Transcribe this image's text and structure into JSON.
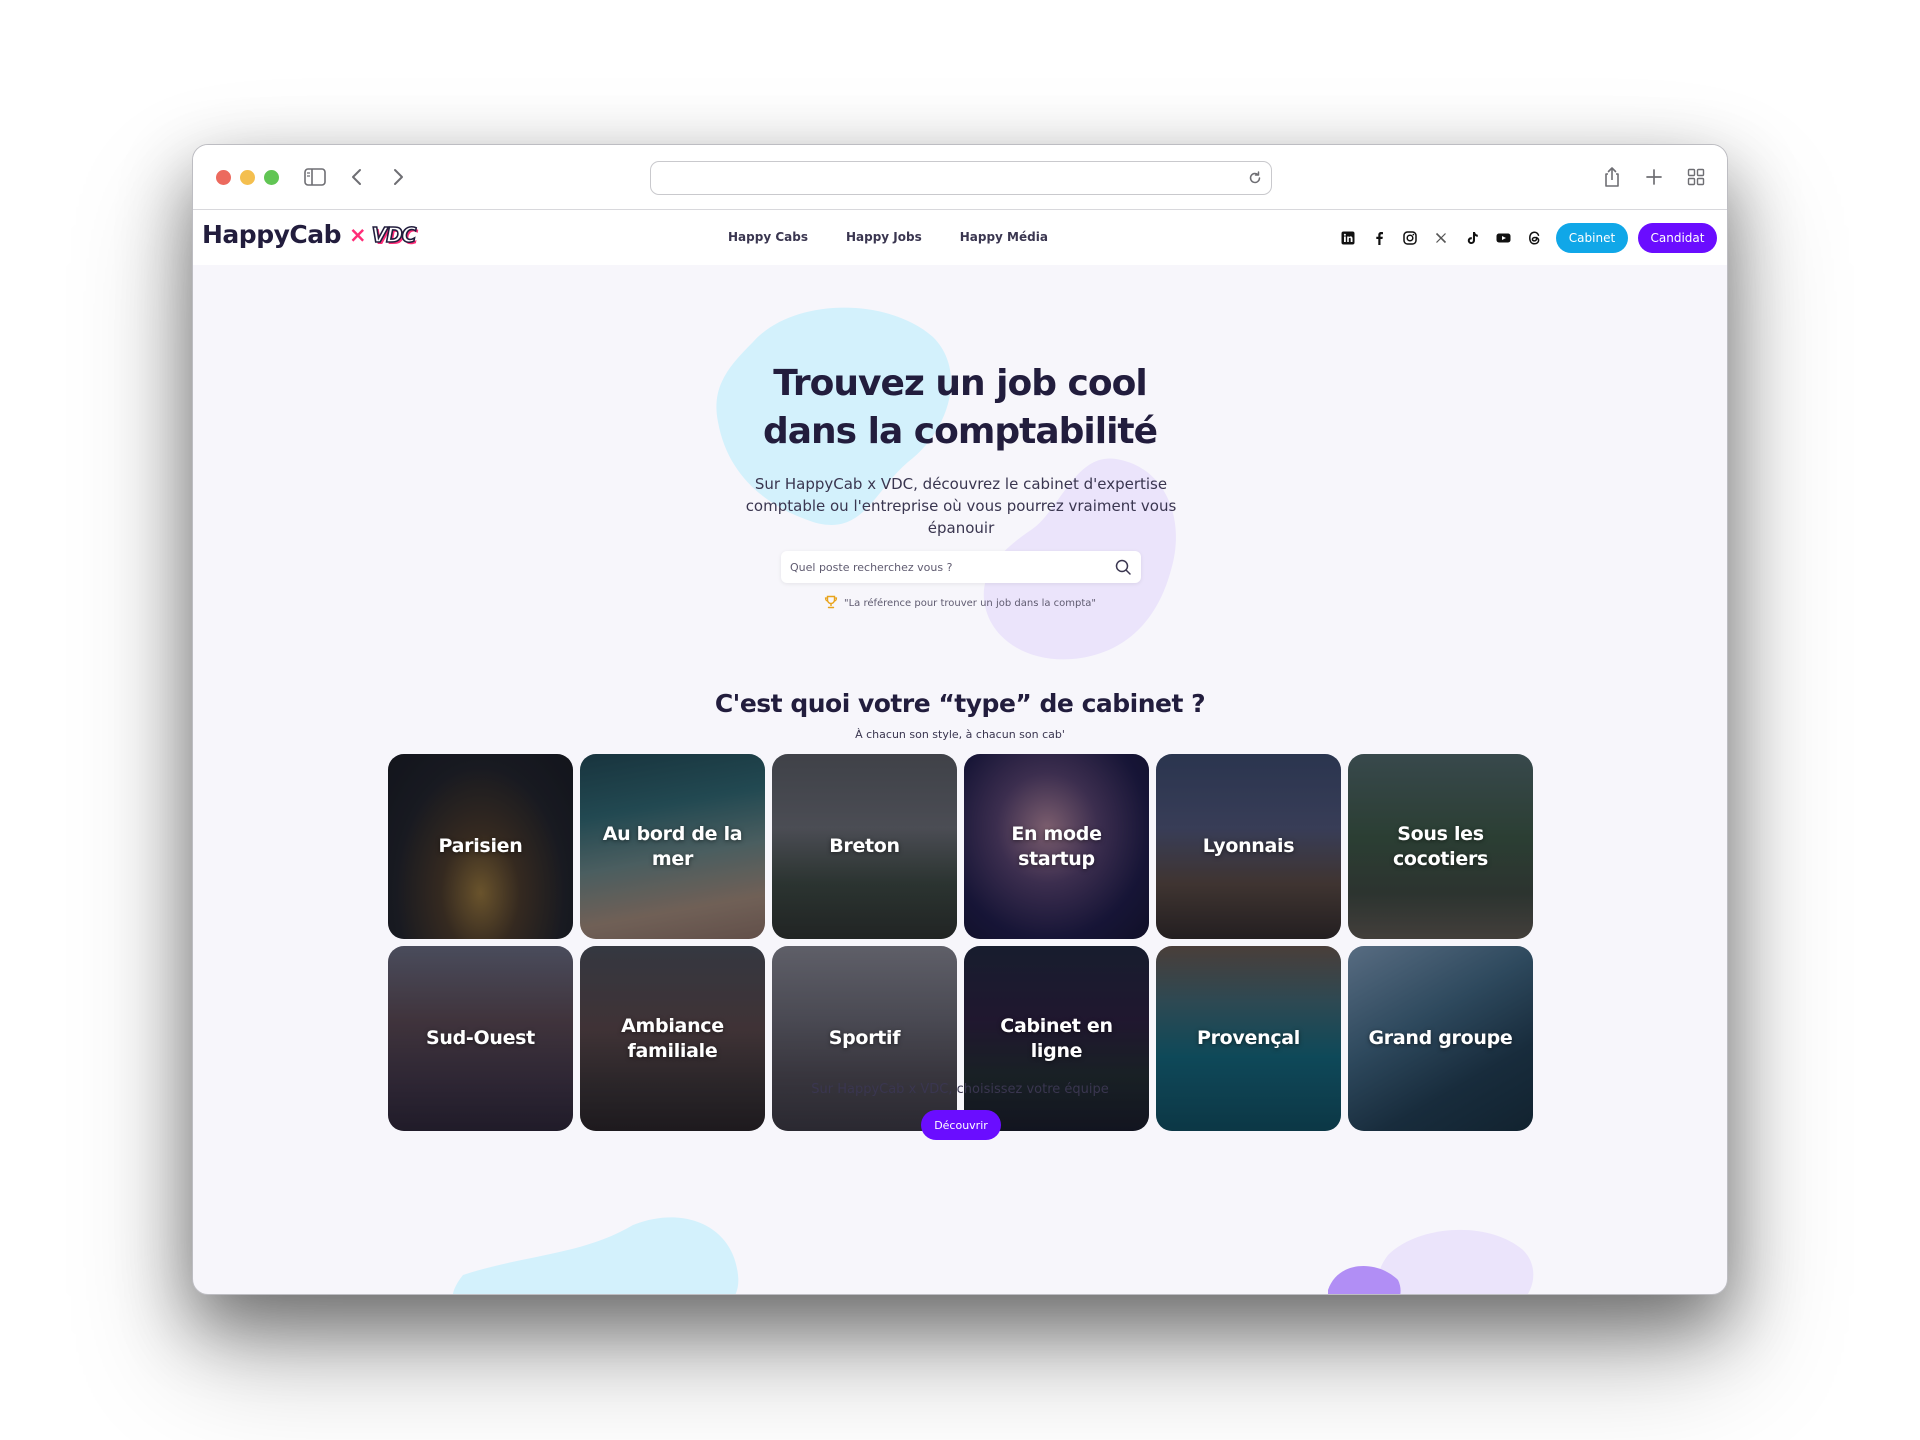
{
  "browser": {
    "url": ""
  },
  "navbar": {
    "logo_main": "HappyCab",
    "logo_x": "×",
    "logo_vdc": "VDC",
    "links": [
      "Happy Cabs",
      "Happy Jobs",
      "Happy Média"
    ],
    "social_icons": [
      "linkedin-icon",
      "facebook-icon",
      "instagram-icon",
      "x-icon",
      "tiktok-icon",
      "youtube-icon",
      "threads-icon"
    ],
    "cabinet_button": "Cabinet",
    "candidat_button": "Candidat"
  },
  "hero": {
    "title_line1": "Trouvez un job cool",
    "title_line2": "dans la comptabilité",
    "subtitle": "Sur HappyCab x VDC, découvrez le cabinet d'expertise comptable ou l'entreprise où vous pourrez vraiment vous épanouir",
    "search_placeholder": "Quel poste recherchez vous ?",
    "tagline": "\"La référence pour trouver un job dans la compta\""
  },
  "types": {
    "title": "C'est quoi votre “type” de cabinet ?",
    "subtitle": "À chacun son style, à chacun son cab'",
    "cards": [
      "Parisien",
      "Au bord de la mer",
      "Breton",
      "En mode startup",
      "Lyonnais",
      "Sous les cocotiers",
      "Sud-Ouest",
      "Ambiance familiale",
      "Sportif",
      "Cabinet en ligne",
      "Provençal",
      "Grand groupe"
    ],
    "bottom_text": "Sur HappyCab x VDC, choisissez votre équipe",
    "cta_button": "Découvrir"
  },
  "colors": {
    "brand_dark": "#221d3d",
    "accent_pink": "#ff2d78",
    "cabinet_blue": "#10a7e8",
    "candidat_purple": "#6a0dff",
    "blob_blue": "#d3f1fc",
    "blob_purple": "#ebe4fb"
  }
}
